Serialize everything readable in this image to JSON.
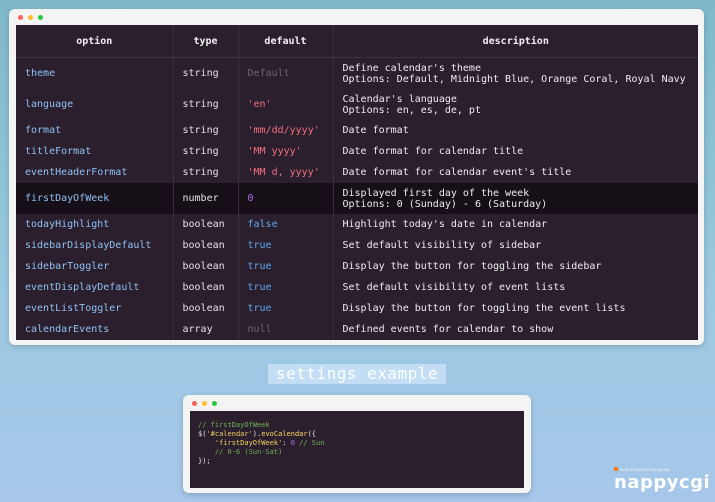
{
  "table": {
    "headers": [
      "option",
      "type",
      "default",
      "description"
    ],
    "rows": [
      {
        "option": "theme",
        "type": "string",
        "default": "Default",
        "default_kind": "default",
        "desc1": "Define calendar's theme",
        "desc2": "Options: Default, Midnight Blue, Orange Coral, Royal Navy"
      },
      {
        "option": "language",
        "type": "string",
        "default": "'en'",
        "default_kind": "str",
        "desc1": "Calendar's language",
        "desc2": "Options: en, es, de, pt"
      },
      {
        "option": "format",
        "type": "string",
        "default": "'mm/dd/yyyy'",
        "default_kind": "str",
        "desc1": "Date format",
        "desc2": ""
      },
      {
        "option": "titleFormat",
        "type": "string",
        "default": "'MM yyyy'",
        "default_kind": "str",
        "desc1": "Date format for calendar title",
        "desc2": ""
      },
      {
        "option": "eventHeaderFormat",
        "type": "string",
        "default": "'MM d, yyyy'",
        "default_kind": "str",
        "desc1": "Date format for calendar event's title",
        "desc2": ""
      },
      {
        "option": "firstDayOfWeek",
        "type": "number",
        "default": "0",
        "default_kind": "num",
        "desc1": "Displayed first day of the week",
        "desc2": "Options: 0 (Sunday) - 6 (Saturday)",
        "highlighted": true
      },
      {
        "option": "todayHighlight",
        "type": "boolean",
        "default": "false",
        "default_kind": "bool",
        "desc1": "Highlight today's date in calendar",
        "desc2": ""
      },
      {
        "option": "sidebarDisplayDefault",
        "type": "boolean",
        "default": "true",
        "default_kind": "bool",
        "desc1": "Set default visibility of sidebar",
        "desc2": ""
      },
      {
        "option": "sidebarToggler",
        "type": "boolean",
        "default": "true",
        "default_kind": "bool",
        "desc1": "Display the button for toggling the sidebar",
        "desc2": ""
      },
      {
        "option": "eventDisplayDefault",
        "type": "boolean",
        "default": "true",
        "default_kind": "bool",
        "desc1": "Set default visibility of event lists",
        "desc2": ""
      },
      {
        "option": "eventListToggler",
        "type": "boolean",
        "default": "true",
        "default_kind": "bool",
        "desc1": "Display the button for toggling the event lists",
        "desc2": ""
      },
      {
        "option": "calendarEvents",
        "type": "array",
        "default": "null",
        "default_kind": "null",
        "desc1": "Defined events for calendar to show",
        "desc2": ""
      }
    ]
  },
  "caption": "settings example",
  "code": {
    "line1": "// firstDayOfWeek",
    "line2_a": "$(",
    "line2_sel": "'#calendar'",
    "line2_b": ").",
    "line2_fn": "evoCalendar",
    "line2_c": "({",
    "line3_key": "'firstDayOfWeek'",
    "line3_colon": ": ",
    "line3_val": "0",
    "line3_com": " // Sun",
    "line4": "// 0-6 (Sun-Sat)",
    "line5": "});"
  },
  "logo": {
    "tagline": "web programming group",
    "word": "nappycgi"
  },
  "colors": {
    "table_bg": "#2b1f2d",
    "option_color": "#8fc0f2",
    "string_default": "#f07080",
    "bool_default": "#5fa7f0",
    "number_default": "#b872f0"
  }
}
